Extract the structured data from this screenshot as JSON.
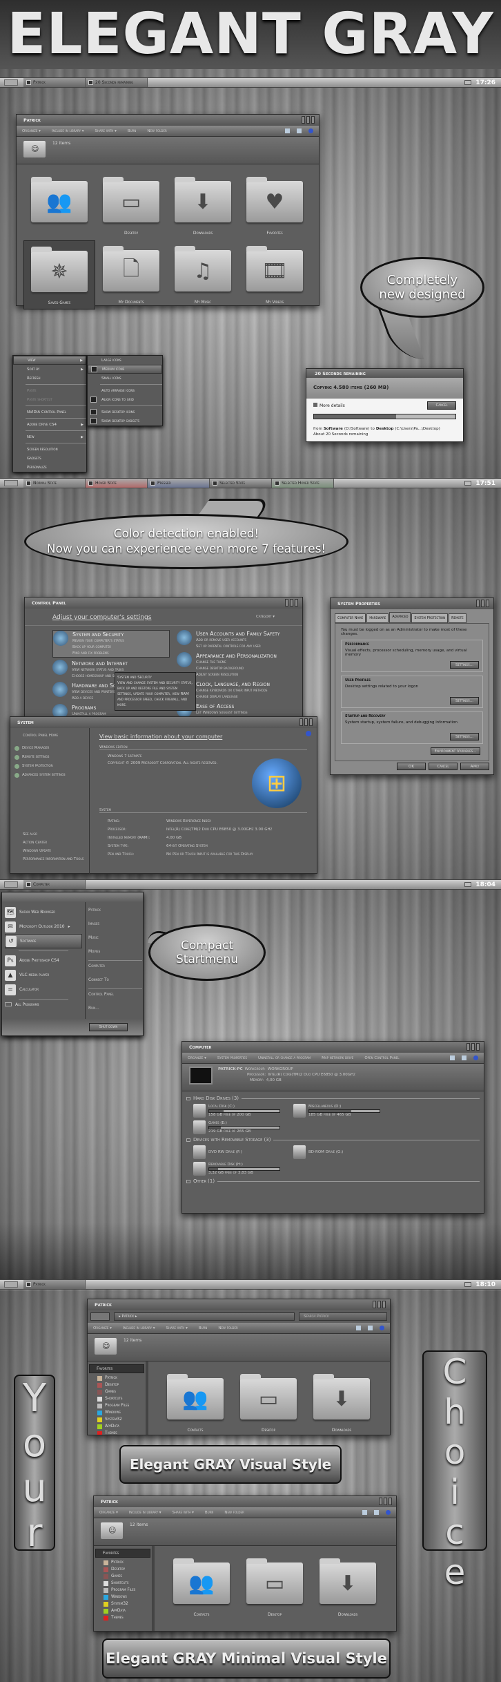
{
  "title": "ELEGANT GRAY",
  "taskbar1": {
    "items": [
      "Patrick",
      "20 Seconds remaining"
    ],
    "clock": "17:26"
  },
  "explorer": {
    "title": "Patrick",
    "commands": [
      "Organize ▾",
      "Include in library ▾",
      "Share with ▾",
      "Burn",
      "New folder"
    ],
    "item_count": "12 items",
    "folders": [
      {
        "label": "",
        "icon": "contacts-icon",
        "glyph": "👥"
      },
      {
        "label": "Desktop",
        "icon": "desktop-icon",
        "glyph": "▭"
      },
      {
        "label": "Downloads",
        "icon": "download-icon",
        "glyph": "⬇"
      },
      {
        "label": "Favorites",
        "icon": "heart-icon",
        "glyph": "♥"
      },
      {
        "label": "Saved Games",
        "icon": "compass-icon",
        "glyph": "✵"
      },
      {
        "label": "My Documents",
        "icon": "document-icon",
        "glyph": "🗋"
      },
      {
        "label": "My Music",
        "icon": "music-icon",
        "glyph": "♫"
      },
      {
        "label": "My Videos",
        "icon": "film-icon",
        "glyph": "🎞"
      }
    ]
  },
  "bubble1": {
    "line1": "Completely",
    "line2": "new designed"
  },
  "context_menu": {
    "items": [
      {
        "label": "View",
        "arrow": true,
        "highlight": true
      },
      {
        "label": "Sort by",
        "arrow": true
      },
      {
        "label": "Refresh"
      },
      {
        "sep": true
      },
      {
        "label": "Paste",
        "disabled": true
      },
      {
        "label": "Paste shortcut",
        "disabled": true
      },
      {
        "sep": true
      },
      {
        "label": "NVIDIA Control Panel"
      },
      {
        "sep": true
      },
      {
        "label": "Adobe Drive CS4",
        "arrow": true
      },
      {
        "sep": true
      },
      {
        "label": "New",
        "arrow": true
      },
      {
        "sep": true
      },
      {
        "label": "Screen resolution"
      },
      {
        "label": "Gadgets"
      },
      {
        "label": "Personalize"
      }
    ],
    "submenu": [
      {
        "label": "Large icons"
      },
      {
        "label": "Medium icons",
        "check": true,
        "highlight": true
      },
      {
        "label": "Small icons"
      },
      {
        "sep": true
      },
      {
        "label": "Auto arrange icons"
      },
      {
        "label": "Align icons to grid",
        "check": true
      },
      {
        "sep": true
      },
      {
        "label": "Show desktop icons",
        "check": true
      },
      {
        "label": "Show desktop gadgets",
        "check": true
      }
    ]
  },
  "copy_dialog": {
    "title": "20 Seconds remaining",
    "heading": "Copying 4.580 items (260 MB)",
    "more_details": "More details",
    "cancel": "Cancel",
    "progress": 0.58,
    "from_label": "from",
    "from_name": "Software",
    "from_path": "(D:\\Software)",
    "to_label": "to",
    "to_name": "Desktop",
    "to_path": "(C:\\Users\\Pa...\\Desktop)",
    "remaining": "About 20 Seconds remaining"
  },
  "taskbar2": {
    "items": [
      "Normal State",
      "Hover State",
      "Pressed",
      "Selected State",
      "Selected Hover State"
    ],
    "colors": [
      "#777777",
      "#b06a6a",
      "#6a7390",
      "#666666",
      "#7a8f7a"
    ],
    "clock": "17:51"
  },
  "bubble2": {
    "line1": "Color detection enabled!",
    "line2": "Now you can experience even more 7 features!"
  },
  "control_panel": {
    "title": "Control Panel",
    "heading": "Adjust your computer's settings",
    "view_by": "Category ▾",
    "left": [
      {
        "title": "System and Security",
        "links": [
          "Review your computer's status",
          "Back up your computer",
          "Find and fix problems"
        ]
      },
      {
        "title": "Network and Internet",
        "links": [
          "View network status and tasks",
          "Choose homegroup and sharing options"
        ]
      },
      {
        "title": "Hardware and Sound",
        "links": [
          "View devices and printers",
          "Add a device"
        ]
      },
      {
        "title": "Programs",
        "links": [
          "Uninstall a program"
        ]
      }
    ],
    "right": [
      {
        "title": "User Accounts and Family Safety",
        "links": [
          "Add or remove user accounts",
          "Set up parental controls for any user"
        ]
      },
      {
        "title": "Appearance and Personalization",
        "links": [
          "Change the theme",
          "Change desktop background",
          "Adjust screen resolution"
        ]
      },
      {
        "title": "Clock, Language, and Region",
        "links": [
          "Change keyboards or other input methods",
          "Change display language"
        ]
      },
      {
        "title": "Ease of Access",
        "links": [
          "Let Windows suggest settings"
        ]
      }
    ],
    "tooltip": {
      "title": "System and Security",
      "text": "View and change system and security status, back up and restore file and system settings, update your computer, view RAM and processor speed, check firewall, and more."
    }
  },
  "system_properties": {
    "title": "System Properties",
    "tabs": [
      "Computer Name",
      "Hardware",
      "Advanced",
      "System Protection",
      "Remote"
    ],
    "active_tab": 2,
    "notice": "You must be logged on as an Administrator to make most of these changes.",
    "groups": [
      {
        "title": "Performance",
        "text": "Visual effects, processor scheduling, memory usage, and virtual memory",
        "button": "Settings..."
      },
      {
        "title": "User Profiles",
        "text": "Desktop settings related to your logon",
        "button": "Settings..."
      },
      {
        "title": "Startup and Recovery",
        "text": "System startup, system failure, and debugging information",
        "button": "Settings..."
      }
    ],
    "env_button": "Environment Variables...",
    "ok": "OK",
    "cancel": "Cancel",
    "apply": "Apply"
  },
  "system": {
    "title": "System",
    "home": "Control Panel Home",
    "tasks": [
      "Device Manager",
      "Remote settings",
      "System protection",
      "Advanced system settings"
    ],
    "see_also_title": "See also",
    "see_also": [
      "Action Center",
      "Windows Update",
      "Performance Information and Tools"
    ],
    "heading": "View basic information about your computer",
    "edition_title": "Windows edition",
    "edition": "Windows 7 Ultimate",
    "copyright": "Copyright © 2009 Microsoft Corporation.  All rights reserved.",
    "system_title": "System",
    "rows": [
      {
        "k": "Rating:",
        "v": "Windows Experience Index"
      },
      {
        "k": "Processor:",
        "v": "Intel(R) Core(TM)2 Duo CPU     E6850  @ 3.00GHz   3.00 GHz"
      },
      {
        "k": "Installed memory (RAM):",
        "v": "4.00 GB"
      },
      {
        "k": "System type:",
        "v": "64-bit Operating System"
      },
      {
        "k": "Pen and Touch:",
        "v": "No Pen or Touch Input is available for this Display"
      }
    ]
  },
  "taskbar3": {
    "items": [
      "Computer"
    ],
    "clock": "18:04"
  },
  "start_menu": {
    "pinned": [
      {
        "label": "Safari Web Browser",
        "glyph": "🗺"
      },
      {
        "label": "Microsoft Outlook 2010",
        "glyph": "✉",
        "arrow": true
      },
      {
        "label": "Software",
        "glyph": "↺",
        "highlight": true
      }
    ],
    "recent": [
      {
        "label": "Adobe Photoshop CS4",
        "glyph": "Ps"
      },
      {
        "label": "VLC media player",
        "glyph": "▲"
      },
      {
        "label": "Calculator",
        "glyph": "="
      }
    ],
    "all_programs": "All Programs",
    "right": [
      "Patrick",
      "Images",
      "Music",
      "Movies",
      "Computer",
      "Connect To",
      "Control Panel",
      "Run..."
    ],
    "shutdown": "Shut down"
  },
  "bubble3": {
    "text": "Compact Startmenu"
  },
  "computer": {
    "title": "Computer",
    "commands": [
      "Organize ▾",
      "System properties",
      "Uninstall or change a program",
      "Map network drive",
      "Open Control Panel"
    ],
    "pc_name": "PATRICK-PC",
    "workgroup_label": "Workgroup:",
    "workgroup": "WORKGROUP",
    "processor_label": "Processor:",
    "processor": "Intel(R) Core(TM)2 Duo CPU    E6850  @ 3.00GHz",
    "memory_label": "Memory:",
    "memory": "4,00 GB",
    "groups": [
      {
        "title": "Hard Disk Drives (3)",
        "drives": [
          {
            "name": "Local Disk (C:)",
            "free": "158 GB free of 200 GB",
            "used": 0.21
          },
          {
            "name": "Miscellaneous (D:)",
            "free": "185 GB free of 465 GB",
            "used": 0.6
          },
          {
            "name": "Games (E:)",
            "free": "219 GB free of 265 GB",
            "used": 0.17
          }
        ]
      },
      {
        "title": "Devices with Removable Storage (3)",
        "drives": [
          {
            "name": "DVD RW Drive (F:)"
          },
          {
            "name": "BD-ROM Drive (G:)"
          },
          {
            "name": "Removable Disk (H:)",
            "free": "3,32 GB free of 3,83 GB",
            "used": 0.13
          }
        ]
      },
      {
        "title": "Other (1)",
        "drives": []
      }
    ]
  },
  "taskbar4": {
    "items": [
      "Patrick"
    ],
    "clock": "18:10"
  },
  "explorer2": {
    "title": "Patrick",
    "breadcrumb": "▸ Patrick ▸",
    "search_placeholder": "Search Patrick",
    "commands": [
      "Organize ▾",
      "Include in library ▾",
      "Share with ▾",
      "Burn",
      "New folder"
    ],
    "item_count": "12 items",
    "nav_header": "Favorites",
    "nav": [
      {
        "label": "Patrick",
        "color": "#c9b49a"
      },
      {
        "label": "Desktop",
        "color": "#a55"
      },
      {
        "label": "Games",
        "color": "#855"
      },
      {
        "label": "Shortcuts",
        "color": "#ddd"
      },
      {
        "label": "Program Files",
        "color": "#bbb"
      },
      {
        "label": "Windows",
        "color": "#2aa7e0"
      },
      {
        "label": "System32",
        "color": "#e0d020"
      },
      {
        "label": "AppData",
        "color": "#a0d020"
      },
      {
        "label": "Themes",
        "color": "#e02020"
      }
    ],
    "folders": [
      {
        "label": "Contacts",
        "glyph": "👥"
      },
      {
        "label": "Desktop",
        "glyph": "▭"
      },
      {
        "label": "Downloads",
        "glyph": "⬇"
      }
    ]
  },
  "your": [
    "Y",
    "o",
    "u",
    "r"
  ],
  "choice": [
    "C",
    "h",
    "o",
    "i",
    "c",
    "e"
  ],
  "label_visual_style": "Elegant GRAY Visual Style",
  "label_minimal_style": "Elegant GRAY Minimal Visual Style"
}
